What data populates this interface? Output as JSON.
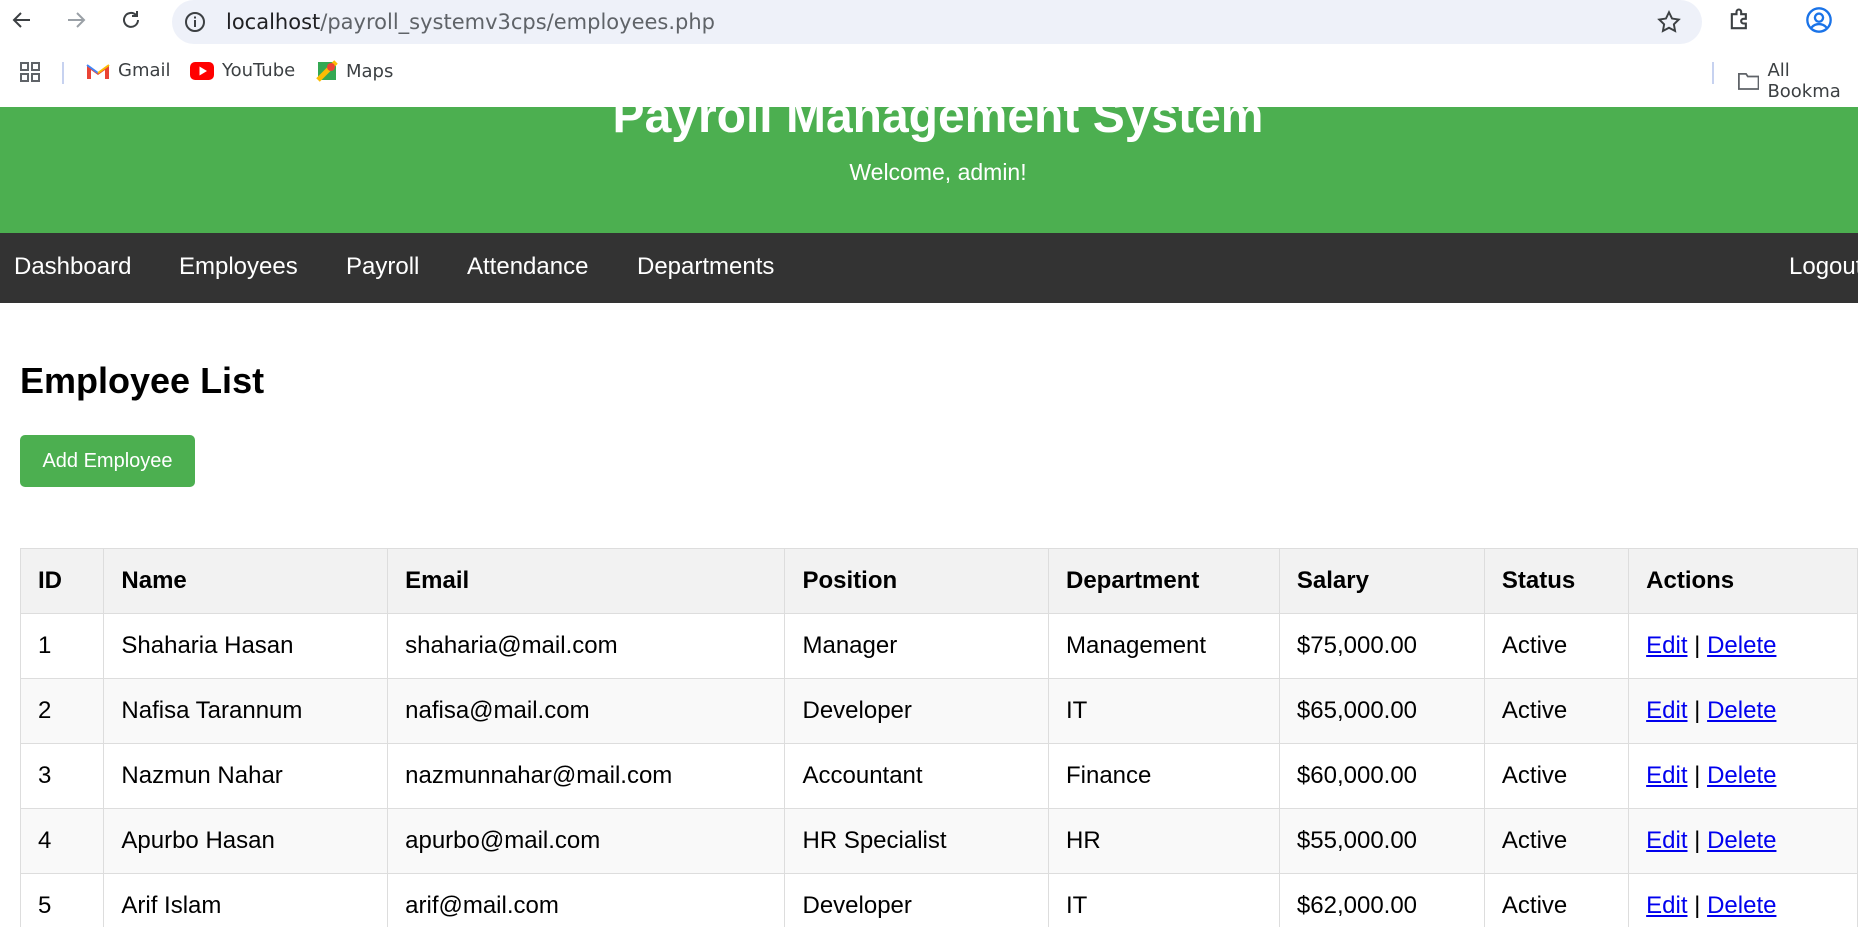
{
  "browser": {
    "url_host": "localhost",
    "url_path": "/payroll_systemv3cps/employees.php",
    "bookmarks": [
      {
        "label": "Gmail",
        "icon": "gmail-icon"
      },
      {
        "label": "YouTube",
        "icon": "youtube-icon"
      },
      {
        "label": "Maps",
        "icon": "maps-icon"
      }
    ],
    "all_bookmarks": "All Bookma"
  },
  "header": {
    "title": "Payroll Management System",
    "welcome": "Welcome, admin!",
    "bg_color": "#4caf50"
  },
  "nav": {
    "items": [
      "Dashboard",
      "Employees",
      "Payroll",
      "Attendance",
      "Departments"
    ],
    "logout": "Logout",
    "bg_color": "#333333"
  },
  "main": {
    "title": "Employee List",
    "add_button": "Add Employee"
  },
  "table": {
    "headers": [
      "ID",
      "Name",
      "Email",
      "Position",
      "Department",
      "Salary",
      "Status",
      "Actions"
    ],
    "rows": [
      {
        "id": "1",
        "name": "Shaharia Hasan",
        "email": "shaharia@mail.com",
        "position": "Manager",
        "department": "Management",
        "salary": "$75,000.00",
        "status": "Active",
        "edit": "Edit",
        "sep": "|",
        "delete": "Delete"
      },
      {
        "id": "2",
        "name": "Nafisa Tarannum",
        "email": "nafisa@mail.com",
        "position": "Developer",
        "department": "IT",
        "salary": "$65,000.00",
        "status": "Active",
        "edit": "Edit",
        "sep": "|",
        "delete": "Delete"
      },
      {
        "id": "3",
        "name": "Nazmun Nahar",
        "email": "nazmunnahar@mail.com",
        "position": "Accountant",
        "department": "Finance",
        "salary": "$60,000.00",
        "status": "Active",
        "edit": "Edit",
        "sep": "|",
        "delete": "Delete"
      },
      {
        "id": "4",
        "name": "Apurbo Hasan",
        "email": "apurbo@mail.com",
        "position": "HR Specialist",
        "department": "HR",
        "salary": "$55,000.00",
        "status": "Active",
        "edit": "Edit",
        "sep": "|",
        "delete": "Delete"
      },
      {
        "id": "5",
        "name": "Arif Islam",
        "email": "arif@mail.com",
        "position": "Developer",
        "department": "IT",
        "salary": "$62,000.00",
        "status": "Active",
        "edit": "Edit",
        "sep": "|",
        "delete": "Delete"
      }
    ]
  }
}
